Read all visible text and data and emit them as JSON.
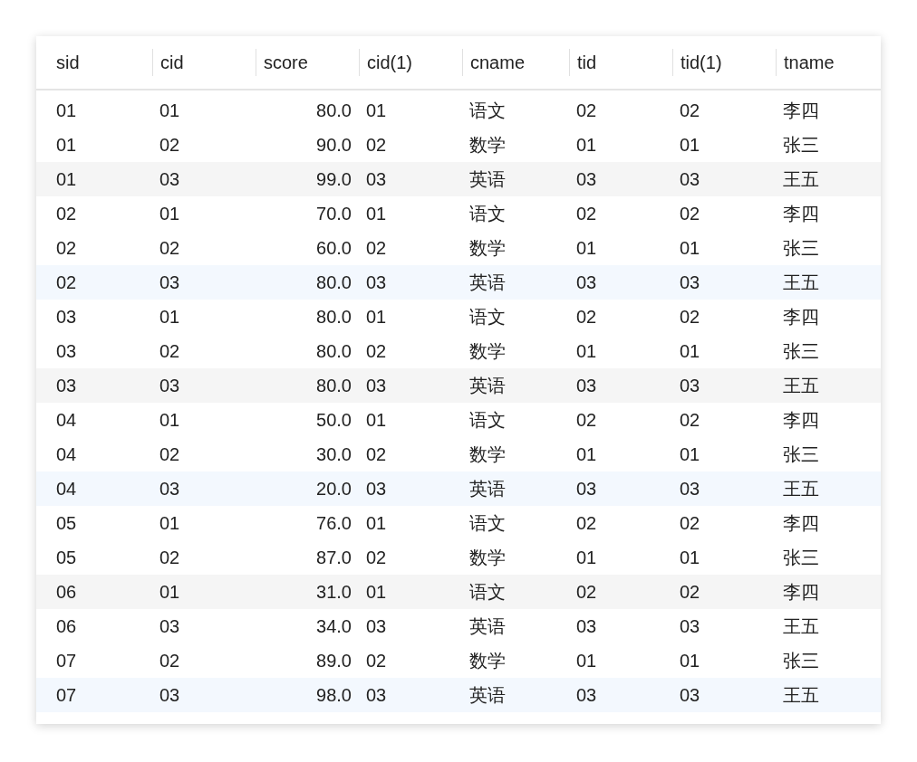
{
  "table": {
    "columns": [
      {
        "label": "sid",
        "kind": "text"
      },
      {
        "label": "cid",
        "kind": "text"
      },
      {
        "label": "score",
        "kind": "number"
      },
      {
        "label": "cid(1)",
        "kind": "text"
      },
      {
        "label": "cname",
        "kind": "text"
      },
      {
        "label": "tid",
        "kind": "text"
      },
      {
        "label": "tid(1)",
        "kind": "text"
      },
      {
        "label": "tname",
        "kind": "text"
      }
    ],
    "rows": [
      {
        "color": "#ffffff",
        "cells": [
          "01",
          "01",
          "80.0",
          "01",
          "语文",
          "02",
          "02",
          "李四"
        ]
      },
      {
        "color": "#ffffff",
        "cells": [
          "01",
          "02",
          "90.0",
          "02",
          "数学",
          "01",
          "01",
          "张三"
        ]
      },
      {
        "color": "#f5f5f5",
        "cells": [
          "01",
          "03",
          "99.0",
          "03",
          "英语",
          "03",
          "03",
          "王五"
        ]
      },
      {
        "color": "#ffffff",
        "cells": [
          "02",
          "01",
          "70.0",
          "01",
          "语文",
          "02",
          "02",
          "李四"
        ]
      },
      {
        "color": "#ffffff",
        "cells": [
          "02",
          "02",
          "60.0",
          "02",
          "数学",
          "01",
          "01",
          "张三"
        ]
      },
      {
        "color": "#f3f8fe",
        "cells": [
          "02",
          "03",
          "80.0",
          "03",
          "英语",
          "03",
          "03",
          "王五"
        ]
      },
      {
        "color": "#ffffff",
        "cells": [
          "03",
          "01",
          "80.0",
          "01",
          "语文",
          "02",
          "02",
          "李四"
        ]
      },
      {
        "color": "#ffffff",
        "cells": [
          "03",
          "02",
          "80.0",
          "02",
          "数学",
          "01",
          "01",
          "张三"
        ]
      },
      {
        "color": "#f5f5f5",
        "cells": [
          "03",
          "03",
          "80.0",
          "03",
          "英语",
          "03",
          "03",
          "王五"
        ]
      },
      {
        "color": "#ffffff",
        "cells": [
          "04",
          "01",
          "50.0",
          "01",
          "语文",
          "02",
          "02",
          "李四"
        ]
      },
      {
        "color": "#ffffff",
        "cells": [
          "04",
          "02",
          "30.0",
          "02",
          "数学",
          "01",
          "01",
          "张三"
        ]
      },
      {
        "color": "#f3f8fe",
        "cells": [
          "04",
          "03",
          "20.0",
          "03",
          "英语",
          "03",
          "03",
          "王五"
        ]
      },
      {
        "color": "#ffffff",
        "cells": [
          "05",
          "01",
          "76.0",
          "01",
          "语文",
          "02",
          "02",
          "李四"
        ]
      },
      {
        "color": "#ffffff",
        "cells": [
          "05",
          "02",
          "87.0",
          "02",
          "数学",
          "01",
          "01",
          "张三"
        ]
      },
      {
        "color": "#f5f5f5",
        "cells": [
          "06",
          "01",
          "31.0",
          "01",
          "语文",
          "02",
          "02",
          "李四"
        ]
      },
      {
        "color": "#ffffff",
        "cells": [
          "06",
          "03",
          "34.0",
          "03",
          "英语",
          "03",
          "03",
          "王五"
        ]
      },
      {
        "color": "#ffffff",
        "cells": [
          "07",
          "02",
          "89.0",
          "02",
          "数学",
          "01",
          "01",
          "张三"
        ]
      },
      {
        "color": "#f3f8fe",
        "cells": [
          "07",
          "03",
          "98.0",
          "03",
          "英语",
          "03",
          "03",
          "王五"
        ]
      }
    ]
  }
}
